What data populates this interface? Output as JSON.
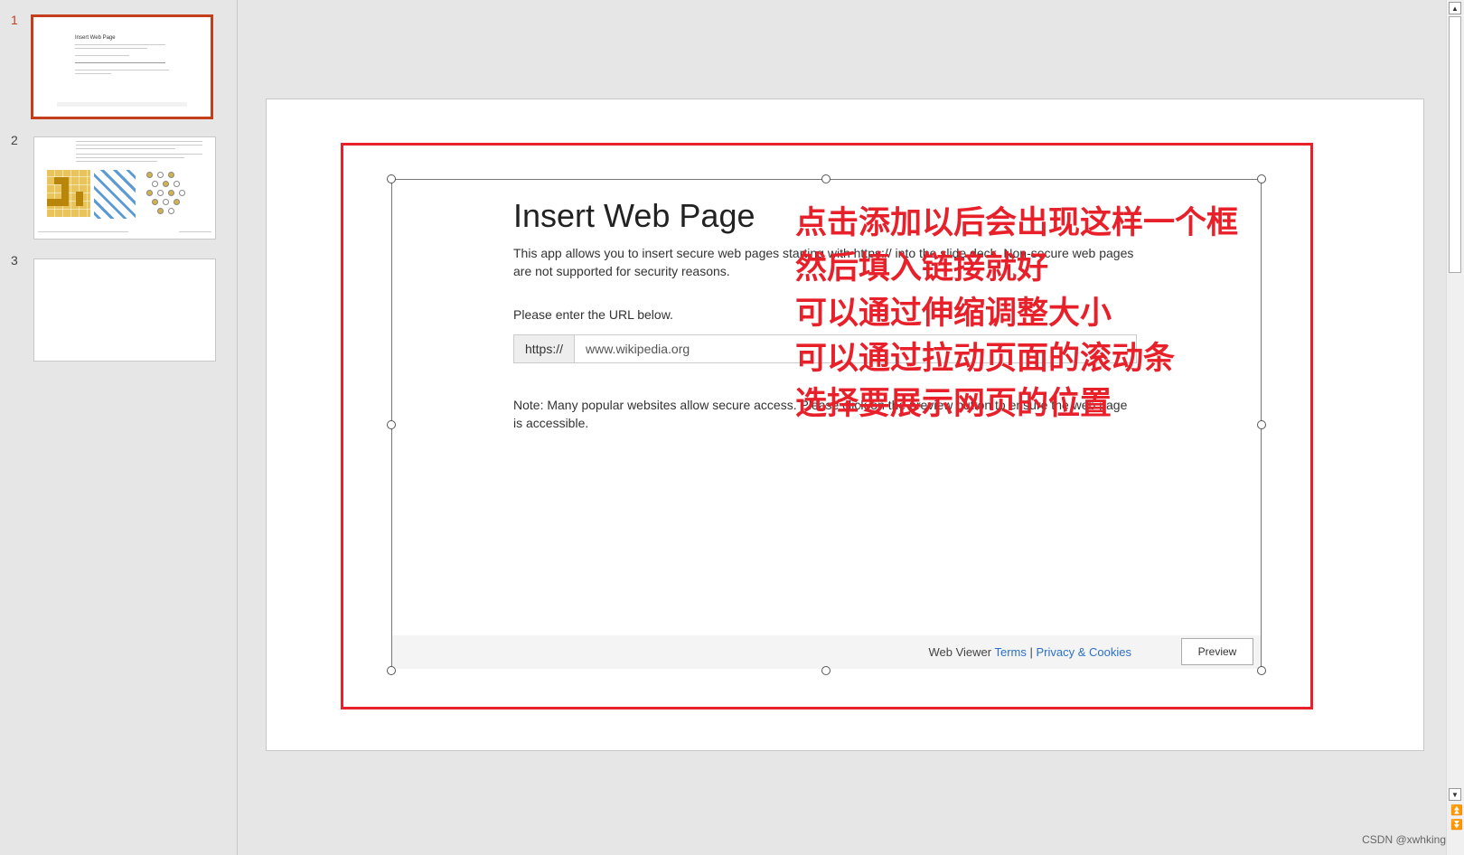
{
  "thumbnails": [
    {
      "number": "1",
      "active": true
    },
    {
      "number": "2",
      "active": false
    },
    {
      "number": "3",
      "active": false
    }
  ],
  "thumb1": {
    "title": "Insert Web Page"
  },
  "web_viewer": {
    "title": "Insert Web Page",
    "description": "This app allows you to insert secure web pages starting with https:// into the slide deck. Non-secure web pages are not supported for security reasons.",
    "url_prompt": "Please enter the URL below.",
    "url_prefix": "https://",
    "url_value": "www.wikipedia.org",
    "note": "Note: Many popular websites allow secure access. Please click on the preview button to ensure the web page is accessible.",
    "footer_label": "Web Viewer",
    "terms_link": "Terms",
    "separator": "|",
    "privacy_link": "Privacy & Cookies",
    "preview_button": "Preview"
  },
  "annotation": {
    "lines": [
      "点击添加以后会出现这样一个框",
      "然后填入链接就好",
      "可以通过伸缩调整大小",
      "可以通过拉动页面的滚动条",
      "选择要展示网页的位置"
    ],
    "color": "#e8202a"
  },
  "colors": {
    "accent": "#c43e1c",
    "link": "#2a6fc9",
    "highlight": "#e8202a"
  },
  "scrollbar": {
    "up_icon": "triangle-up",
    "down_icon": "triangle-down",
    "prev_page_icon": "double-arrow-up",
    "next_page_icon": "double-arrow-down"
  },
  "watermark": "CSDN @xwhking"
}
